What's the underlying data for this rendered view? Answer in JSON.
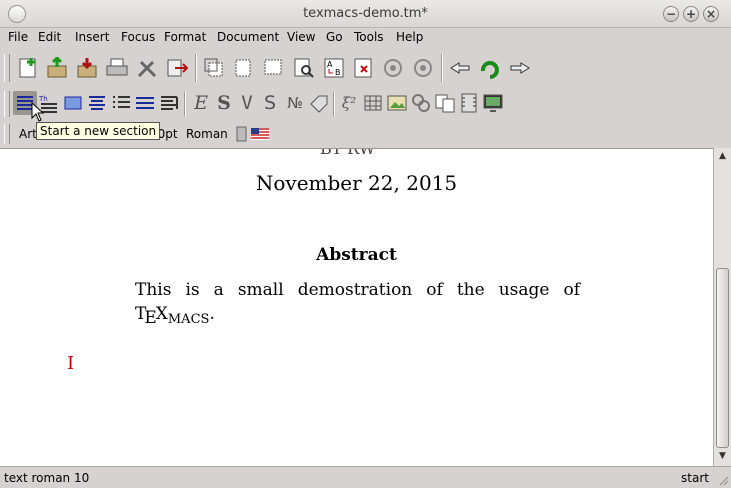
{
  "window": {
    "title": "texmacs-demo.tm*"
  },
  "menu": [
    "File",
    "Edit",
    "Insert",
    "Focus",
    "Format",
    "Document",
    "View",
    "Go",
    "Tools",
    "Help"
  ],
  "format_bar": {
    "style": "Art",
    "size": "10pt",
    "font": "Roman"
  },
  "tooltip": "Start a new section",
  "document": {
    "author_fragment": "BY RW",
    "date": "November 22, 2015",
    "abstract_title": "Abstract",
    "abstract_line1": "This is a small demostration of the usage of",
    "abstract_line2_suffix": "."
  },
  "status": {
    "left": "text roman 10",
    "right": "start"
  },
  "icons": {
    "toolbar1": [
      "new-document",
      "open-file",
      "save-file",
      "print",
      "preferences",
      "export",
      "copy",
      "paste",
      "cut",
      "search",
      "replace",
      "spell-check",
      "undo",
      "redo",
      "back",
      "reload",
      "forward"
    ],
    "toolbar2": [
      "section",
      "theorem",
      "center-block",
      "align-justify",
      "itemize",
      "enumerate",
      "description",
      "emphasize",
      "strong",
      "verbatim",
      "sans-serif",
      "number",
      "label",
      "math",
      "table",
      "image",
      "link",
      "footnote",
      "animation",
      "presentation"
    ]
  }
}
